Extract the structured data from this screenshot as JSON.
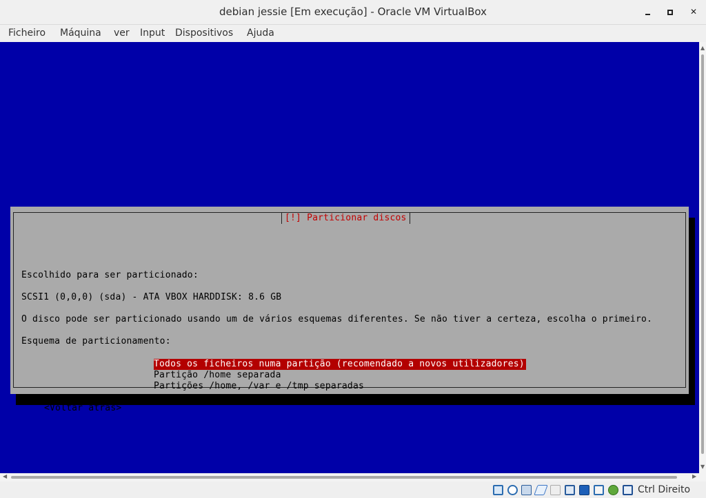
{
  "window": {
    "title": "debian jessie [Em execução] - Oracle VM VirtualBox"
  },
  "menu": {
    "items": [
      "Ficheiro",
      "Máquina",
      "ver",
      "Input",
      "Dispositivos",
      "Ajuda"
    ]
  },
  "installer": {
    "dialog_title": "[!] Particionar discos",
    "chosen_label": "Escolhido para ser particionado:",
    "disk": "SCSI1 (0,0,0) (sda) - ATA VBOX HARDDISK: 8.6 GB",
    "description": "O disco pode ser particionado usando um de vários esquemas diferentes. Se não tiver a certeza, escolha o primeiro.",
    "scheme_label": "Esquema de particionamento:",
    "options": [
      "Todos os ficheiros numa partição (recomendado a novos utilizadores)",
      "Partição /home separada",
      "Partições /home, /var e /tmp separadas"
    ],
    "selected_index": 0,
    "back_button": "<Voltar atrás>"
  },
  "status_bar": {
    "icons": [
      "hard-disk-icon",
      "optical-drive-icon",
      "audio-icon",
      "network-icon",
      "usb-icon",
      "shared-folders-icon",
      "display-icon",
      "video-capture-icon",
      "virtualization-icon",
      "mouse-integration-icon",
      "keyboard-capture-icon"
    ],
    "host_key": "Ctrl Direito"
  },
  "colors": {
    "vm_background": "#0000a8",
    "dialog_background": "#aaaaaa",
    "dialog_title": "#c20000",
    "selection": "#b30000"
  }
}
